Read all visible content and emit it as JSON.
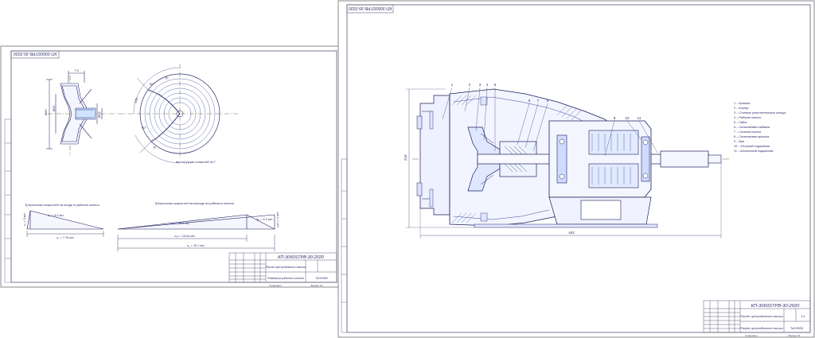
{
  "sheet1": {
    "stamp_top": "КП-3060STPВ-30-2020",
    "view1_dims": [
      "7.6",
      "Ø50",
      "Ø32",
      "Ø24"
    ],
    "view2_dims": [
      "β₂",
      "60°",
      "128",
      "90°",
      "ρ₁",
      "r₁"
    ],
    "view2_caption": "Конструкция лопастей по Г",
    "tri1_caption": "Треугольник скоростей на входе в рабочее колесо",
    "tri1_labels": {
      "w": "w₁ = 8.2 м/с",
      "c": "c₁ = 3 м/с",
      "u": "u₁ = 7.76 м/с"
    },
    "tri2_caption": "Треугольник скоростей на выходе из рабочего колеса",
    "tri2_labels": {
      "w": "c₂u = 16.6 м/с",
      "c": "w₂ = 4.2 м/с",
      "cm": "c₂m = 4 м/с",
      "cu": "c₂u = 16.64 м/с",
      "u": "u₂ = 19.1 м/с"
    },
    "title_block": {
      "code": "КП-3060STPВ-30-2020",
      "name": "Расчет центробежного насоса",
      "sheet_name": "Развёртка рабочего колеса",
      "group": "ТаЭЭ305",
      "format": "Формат   А1",
      "copy": "Копировал"
    }
  },
  "sheet2": {
    "stamp_top": "КП-3060STPВ-30-2020",
    "dim_height": "218",
    "dim_length": "442",
    "callouts": [
      "1",
      "2",
      "3",
      "4",
      "5",
      "6",
      "7",
      "8",
      "9",
      "10",
      "11"
    ],
    "legend": [
      "1 – Крышка",
      "2 – Корпус",
      "3 – Стопные уплотнительные кольца",
      "4 – Рабочее колесо",
      "5 – Гайка",
      "6 – Сальниковая набивка",
      "7 – Сальник втулка",
      "8 – Сальниковая крышка",
      "9 – Вал",
      "10 – Опорный подшипник",
      "11 – Шпоночный подшипник"
    ],
    "title_block": {
      "code": "КП-3060STPВ-30-2020",
      "name": "Расчет центробежного насоса",
      "sheet_name": "Разрез центробежного насоса",
      "group": "ТаЭЭ305",
      "sheet_no": "1:1",
      "format": "Формат   А1",
      "copy": "Копировал"
    }
  }
}
